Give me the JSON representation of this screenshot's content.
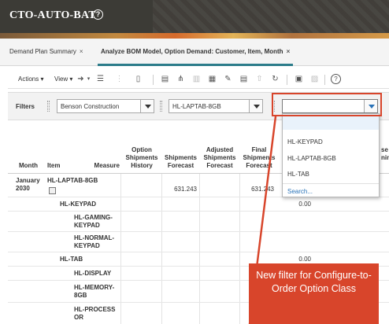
{
  "app": {
    "title": "CTO-AUTO-BAT"
  },
  "tabs": [
    {
      "label": "Demand Plan Summary"
    },
    {
      "label": "Analyze BOM Model, Option Demand: Customer, Item, Month"
    }
  ],
  "toolbar": {
    "actions_label": "Actions",
    "view_label": "View"
  },
  "filters": {
    "label": "Filters",
    "customer_value": "Benson Construction",
    "item_value": "HL-LAPTAB-8GB",
    "option_class_value": ""
  },
  "dropdown": {
    "options": [
      "HL-KEYPAD",
      "HL-LAPTAB-8GB",
      "HL-TAB"
    ],
    "search_label": "Search..."
  },
  "grid": {
    "headers": {
      "month": "Month",
      "item": "Item",
      "measure": "Measure",
      "option_shipments_history": "Option Shipments History",
      "shipments_forecast": "Shipments Forecast",
      "adjusted_shipments_forecast": "Adjusted Shipments Forecast",
      "final_shipments_forecast": "Final Shipments Forecast",
      "partial_right": "se ning"
    },
    "month": "January 2030",
    "rows": [
      {
        "item": "HL-LAPTAB-8GB",
        "shipments_forecast": "631.243",
        "final_shipments_forecast": "631.243",
        "extra": ""
      },
      {
        "item": "HL-KEYPAD",
        "shipments_forecast": "",
        "final_shipments_forecast": "",
        "extra": "0.00"
      },
      {
        "item": "HL-GAMING-KEYPAD",
        "shipments_forecast": "",
        "final_shipments_forecast": "",
        "extra": ""
      },
      {
        "item": "HL-NORMAL-KEYPAD",
        "shipments_forecast": "",
        "final_shipments_forecast": "",
        "extra": ""
      },
      {
        "item": "HL-TAB",
        "shipments_forecast": "",
        "final_shipments_forecast": "",
        "extra": "0.00"
      },
      {
        "item": "HL-DISPLAY",
        "shipments_forecast": "",
        "final_shipments_forecast": "",
        "extra": ""
      },
      {
        "item": "HL-MEMORY-8GB",
        "shipments_forecast": "",
        "final_shipments_forecast": "",
        "extra": ""
      },
      {
        "item": "HL-PROCESSOR",
        "shipments_forecast": "",
        "final_shipments_forecast": "",
        "extra": ""
      }
    ]
  },
  "callout": {
    "text": "New filter for Configure-to-Order Option Class"
  },
  "colors": {
    "accent_red": "#d8452b",
    "tab_underline": "#2c7c8a",
    "link_blue": "#2a73b8"
  }
}
